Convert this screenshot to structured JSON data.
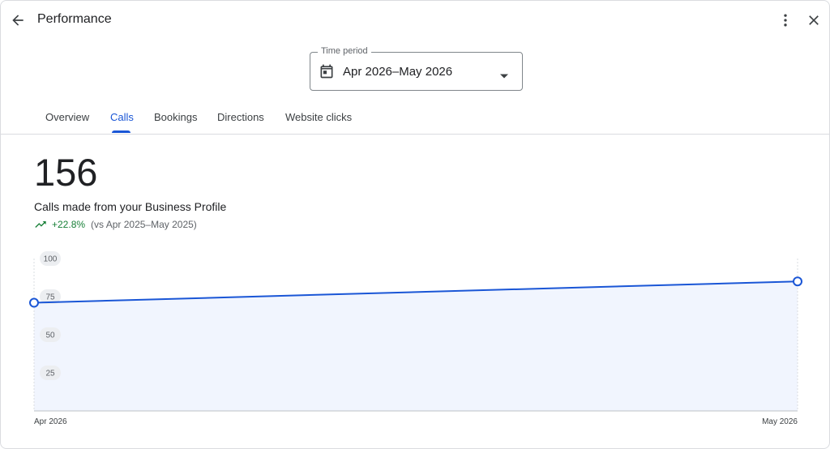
{
  "header": {
    "title": "Performance"
  },
  "time_period": {
    "legend": "Time period",
    "value": "Apr 2026–May 2026"
  },
  "tabs": [
    {
      "label": "Overview",
      "active": false
    },
    {
      "label": "Calls",
      "active": true
    },
    {
      "label": "Bookings",
      "active": false
    },
    {
      "label": "Directions",
      "active": false
    },
    {
      "label": "Website clicks",
      "active": false
    }
  ],
  "metric": {
    "value": "156",
    "label": "Calls made from your Business Profile",
    "change": "+22.8%",
    "comparison": "(vs Apr 2025–May 2025)"
  },
  "colors": {
    "accent": "#1a56d6",
    "positive": "#188038",
    "area_fill": "#f1f5fe"
  },
  "chart_data": {
    "type": "area",
    "x": [
      "Apr 2026",
      "May 2026"
    ],
    "values": [
      71,
      85
    ],
    "y_ticks": [
      25,
      50,
      75,
      100
    ],
    "ylim": [
      0,
      100
    ],
    "grid": false
  }
}
